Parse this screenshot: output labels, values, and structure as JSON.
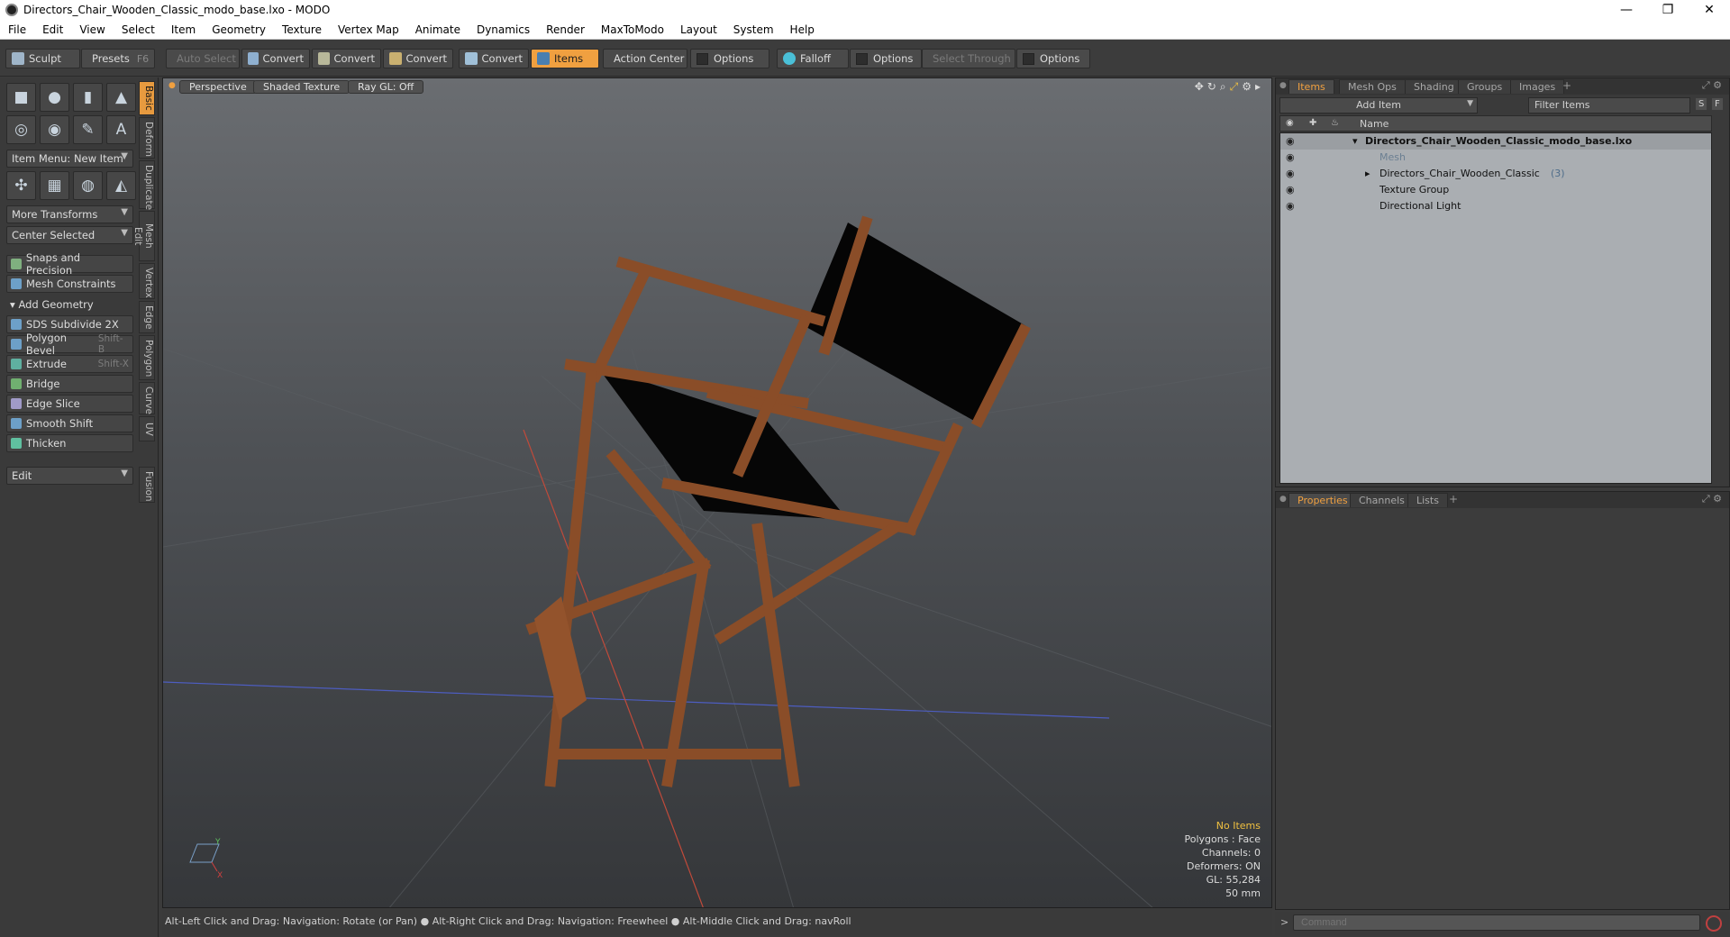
{
  "window": {
    "title": "Directors_Chair_Wooden_Classic_modo_base.lxo - MODO",
    "min": "—",
    "max": "❐",
    "close": "✕"
  },
  "menu": [
    "File",
    "Edit",
    "View",
    "Select",
    "Item",
    "Geometry",
    "Texture",
    "Vertex Map",
    "Animate",
    "Dynamics",
    "Render",
    "MaxToModo",
    "Layout",
    "System",
    "Help"
  ],
  "toolbar": {
    "sculpt": "Sculpt",
    "presets": "Presets",
    "presets_shortcut": "F6",
    "auto_select": "Auto Select",
    "convert1": "Convert",
    "convert2": "Convert",
    "convert3": "Convert",
    "convert4": "Convert",
    "items": "Items",
    "action_center": "Action Center",
    "options1": "Options",
    "falloff": "Falloff",
    "options2": "Options",
    "select_through": "Select Through",
    "options3": "Options"
  },
  "left": {
    "item_menu": "Item Menu: New Item",
    "more_transforms": "More Transforms",
    "center_selected": "Center Selected",
    "snaps": "Snaps and Precision",
    "mesh_constraints": "Mesh Constraints",
    "add_geometry": "Add Geometry",
    "tools": [
      {
        "label": "SDS Subdivide 2X",
        "sc": ""
      },
      {
        "label": "Polygon Bevel",
        "sc": "Shift-B"
      },
      {
        "label": "Extrude",
        "sc": "Shift-X"
      },
      {
        "label": "Bridge",
        "sc": ""
      },
      {
        "label": "Edge Slice",
        "sc": ""
      },
      {
        "label": "Smooth Shift",
        "sc": ""
      },
      {
        "label": "Thicken",
        "sc": ""
      }
    ],
    "edit": "Edit",
    "vtabs": [
      "Basic",
      "Deform",
      "Duplicate",
      "Mesh Edit",
      "Vertex",
      "Edge",
      "Polygon",
      "Curve",
      "UV",
      "Fusion"
    ]
  },
  "viewport": {
    "view": "Perspective",
    "shading": "Shaded Texture",
    "raygl": "Ray GL: Off",
    "stats": {
      "items": "No Items",
      "polygons": "Polygons : Face",
      "channels": "Channels: 0",
      "deformers": "Deformers: ON",
      "gl": "GL: 55,284",
      "size": "50 mm"
    },
    "status": "Alt-Left Click and Drag: Navigation: Rotate (or Pan) ● Alt-Right Click and Drag: Navigation: Freewheel ● Alt-Middle Click and Drag: navRoll"
  },
  "items_panel": {
    "tabs": [
      "Items",
      "Mesh Ops",
      "Shading",
      "Groups",
      "Images"
    ],
    "add_item": "Add Item",
    "filter": "Filter Items",
    "col_name": "Name",
    "tree": [
      {
        "label": "Directors_Chair_Wooden_Classic_modo_base.lxo",
        "count": "",
        "bold": true
      },
      {
        "label": "Mesh",
        "count": "",
        "dim": true
      },
      {
        "label": "Directors_Chair_Wooden_Classic",
        "count": "(3)"
      },
      {
        "label": "Texture Group",
        "count": ""
      },
      {
        "label": "Directional Light",
        "count": ""
      }
    ]
  },
  "props_panel": {
    "tabs": [
      "Properties",
      "Channels",
      "Lists"
    ]
  },
  "command": {
    "placeholder": "Command"
  },
  "colors": {
    "accent": "#f0a040",
    "bg": "#3a3a3a"
  },
  "icons": [
    "sculpt-icon",
    "presets-icon",
    "cube-icon",
    "sphere-icon",
    "cylinder-icon",
    "cone-icon",
    "torus-icon",
    "eye-icon"
  ]
}
